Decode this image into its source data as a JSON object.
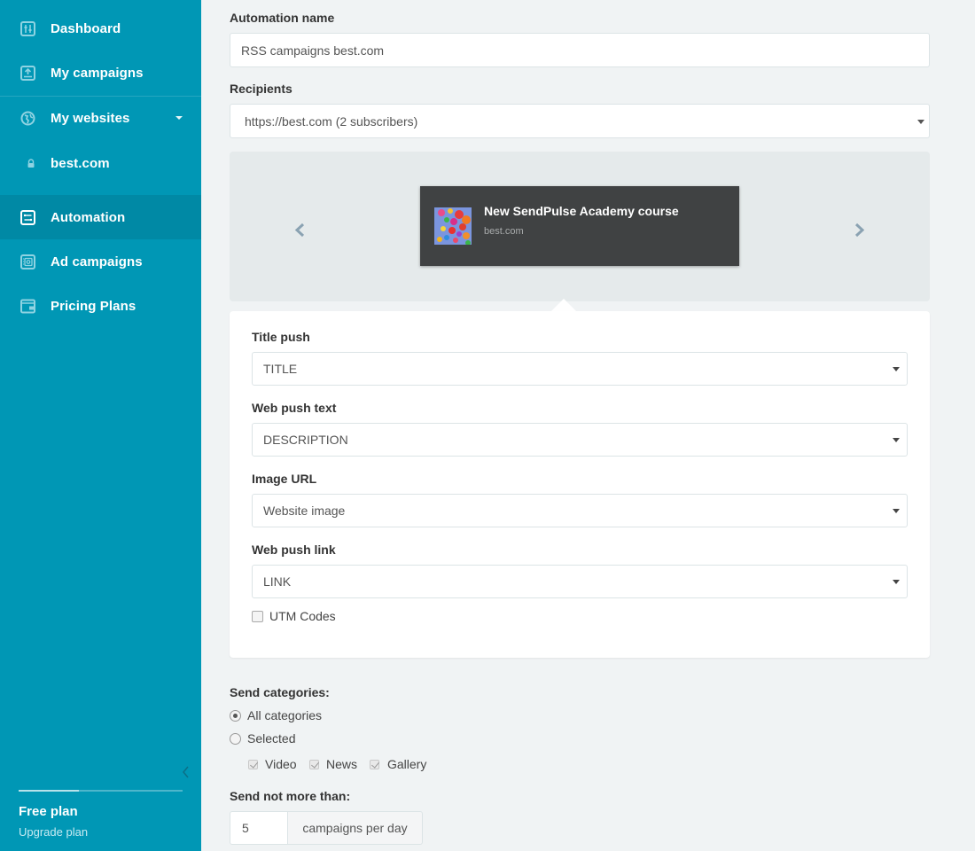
{
  "sidebar": {
    "items": [
      {
        "label": "Dashboard",
        "icon": "dashboard-sliders-icon"
      },
      {
        "label": "My campaigns",
        "icon": "campaigns-upload-icon"
      },
      {
        "label": "My websites",
        "icon": "globe-icon",
        "expanded": true
      },
      {
        "label": "best.com",
        "icon": "lock-icon"
      },
      {
        "label": "Automation",
        "icon": "automation-icon",
        "active": true
      },
      {
        "label": "Ad campaigns",
        "icon": "ad-campaigns-icon"
      },
      {
        "label": "Pricing Plans",
        "icon": "wallet-icon"
      }
    ],
    "plan": {
      "name": "Free plan",
      "upgrade_label": "Upgrade plan",
      "usage_fraction": 0.37
    },
    "collapse_icon": "chevron-left-icon"
  },
  "form": {
    "automation_name": {
      "label": "Automation name",
      "value": "RSS campaigns best.com"
    },
    "recipients": {
      "label": "Recipients",
      "value": "https://best.com (2 subscribers)"
    }
  },
  "preview": {
    "title": "New SendPulse Academy course",
    "site": "best.com",
    "prev_icon": "chevron-left-icon",
    "next_icon": "chevron-right-icon"
  },
  "push_settings": {
    "title_push": {
      "label": "Title push",
      "value": "TITLE"
    },
    "push_text": {
      "label": "Web push text",
      "value": "DESCRIPTION"
    },
    "image_url": {
      "label": "Image URL",
      "value": "Website image"
    },
    "push_link": {
      "label": "Web push link",
      "value": "LINK"
    },
    "utm": {
      "label": "UTM Codes",
      "checked": false
    }
  },
  "categories": {
    "label": "Send categories:",
    "options": [
      {
        "label": "All categories",
        "checked": true
      },
      {
        "label": "Selected",
        "checked": false
      }
    ],
    "items": [
      {
        "label": "Video",
        "checked": true
      },
      {
        "label": "News",
        "checked": true
      },
      {
        "label": "Gallery",
        "checked": true
      }
    ]
  },
  "limit": {
    "label": "Send not more than:",
    "value": "5",
    "unit": "campaigns per day"
  },
  "colors": {
    "sidebar_bg": "#0097b5",
    "sidebar_active": "#0089a5",
    "page_bg": "#f0f3f4",
    "push_card_bg": "#404243"
  }
}
